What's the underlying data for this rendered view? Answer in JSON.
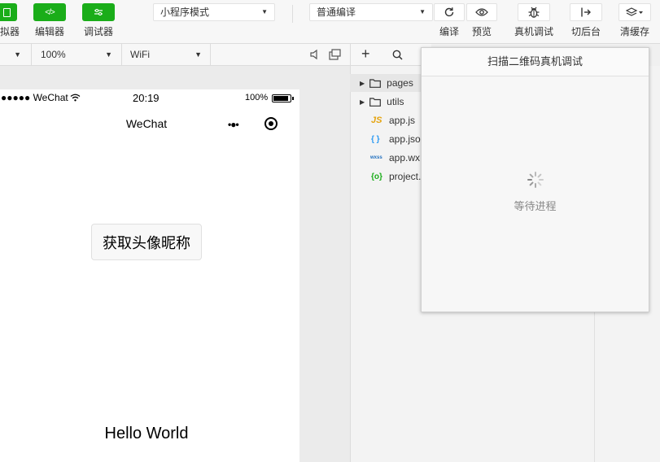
{
  "toolbar": {
    "simulator_label": "拟器",
    "editor_label": "编辑器",
    "debugger_label": "调试器",
    "mode_select": "小程序模式",
    "compile_select": "普通编译",
    "compile_label": "编译",
    "preview_label": "预览",
    "remote_debug_label": "真机调试",
    "background_label": "切后台",
    "clear_cache_label": "清缓存"
  },
  "device_bar": {
    "zoom": "100%",
    "network": "WiFi"
  },
  "phone": {
    "carrier": "●●●●● WeChat",
    "time": "20:19",
    "battery": "100%",
    "nav_title": "WeChat",
    "button_label": "获取头像昵称",
    "hello_text": "Hello World"
  },
  "file_tree": {
    "items": [
      {
        "name": "pages",
        "type": "folder"
      },
      {
        "name": "utils",
        "type": "folder"
      },
      {
        "name": "app.js",
        "type": "js",
        "badge": "JS"
      },
      {
        "name": "app.jso",
        "type": "json",
        "badge": "{ }"
      },
      {
        "name": "app.wx",
        "type": "wxss",
        "badge": "wxss"
      },
      {
        "name": "project.",
        "type": "config",
        "badge": "{o}"
      }
    ]
  },
  "popup": {
    "title": "扫描二维码真机调试",
    "status": "等待进程"
  },
  "colors": {
    "accent": "#1aad19",
    "js_badge": "#e5a30c",
    "json_badge": "#2b9af3",
    "wxss_badge": "#1f6fbf",
    "config_badge": "#1aad19"
  }
}
